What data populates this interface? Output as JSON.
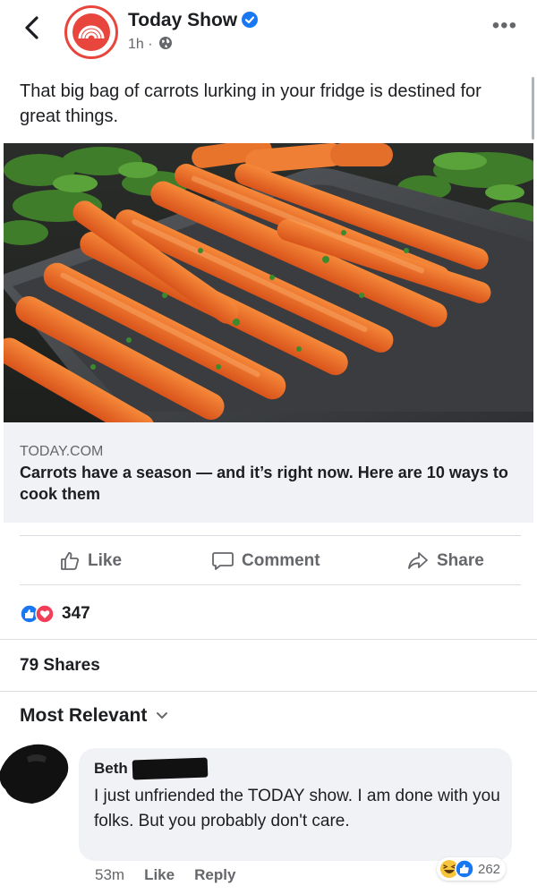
{
  "post": {
    "page_name": "Today Show",
    "time": "1h",
    "dot": "·",
    "caption": "That big bag of carrots lurking in your fridge is destined for great things."
  },
  "link": {
    "domain": "TODAY.COM",
    "title": "Carrots have a season — and it’s right now. Here are 10 ways to cook them"
  },
  "actions": {
    "like": "Like",
    "comment": "Comment",
    "share": "Share"
  },
  "stats": {
    "reactions": "347",
    "shares": "79 Shares"
  },
  "comments": {
    "sort_label": "Most Relevant",
    "items": [
      {
        "author": "Beth",
        "text": "I just unfriended the TODAY show. I am done with you folks. But you probably don't care.",
        "time": "53m",
        "like": "Like",
        "reply": "Reply",
        "reactions": "262"
      }
    ]
  },
  "colors": {
    "accent_blue": "#1877f2",
    "love_red": "#f33e58",
    "brand_red": "#e8453c",
    "muted": "#65676b"
  },
  "icons": [
    "back-icon",
    "today-logo",
    "verified-icon",
    "globe-icon",
    "more-icon",
    "like-icon",
    "comment-icon",
    "share-icon",
    "chevron-down-icon"
  ]
}
